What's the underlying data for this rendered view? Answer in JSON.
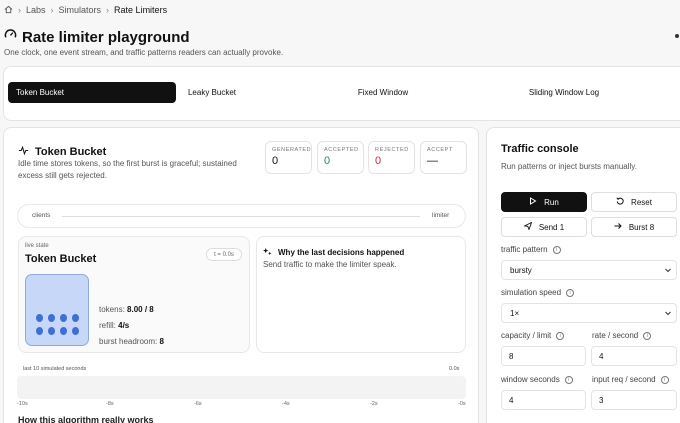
{
  "breadcrumb": {
    "items": [
      "Labs",
      "Simulators"
    ],
    "current": "Rate Limiters"
  },
  "header": {
    "title": "Rate limiter playground",
    "subtitle": "One clock, one event stream, and traffic patterns readers can actually provoke."
  },
  "tabs": [
    {
      "label": "Token Bucket",
      "active": true
    },
    {
      "label": "Leaky Bucket",
      "active": false
    },
    {
      "label": "Fixed Window",
      "active": false
    },
    {
      "label": "Sliding Window Log",
      "active": false
    }
  ],
  "main": {
    "title": "Token Bucket",
    "description": "Idle time stores tokens, so the first burst is graceful; sustained excess still gets rejected.",
    "stats": [
      {
        "label": "GENERATED",
        "value": "0",
        "color": "#111111"
      },
      {
        "label": "ACCEPTED",
        "value": "0",
        "color": "#1f8a5b"
      },
      {
        "label": "REJECTED",
        "value": "0",
        "color": "#c8283c"
      },
      {
        "label": "ACCEPT",
        "value": "—",
        "color": "#111111"
      }
    ],
    "lane": {
      "left": "clients",
      "right": "limiter"
    },
    "state": {
      "eyebrow": "live state",
      "title": "Token Bucket",
      "clock": "t = 0.0s",
      "tokens_label": "tokens:",
      "tokens_value": "8.00 / 8",
      "refill_label": "refill:",
      "refill_value": "4/s",
      "headroom_label": "burst headroom:",
      "headroom_value": "8",
      "fill_fraction": 1.0
    },
    "why": {
      "title": "Why the last decisions happened",
      "body": "Send traffic to make the limiter speak."
    },
    "timeline": {
      "label": "last 10 simulated seconds",
      "now": "0.0s",
      "ticks": [
        "-10s",
        "-8s",
        "-6s",
        "-4s",
        "-2s",
        "-0s"
      ]
    },
    "next_section": "How this algorithm really works"
  },
  "console": {
    "title": "Traffic console",
    "description": "Run patterns or inject bursts manually.",
    "run_label": "Run",
    "reset_label": "Reset",
    "send1_label": "Send 1",
    "send8_label": "Burst 8",
    "pattern_label": "traffic pattern",
    "pattern_value": "bursty",
    "speed_label": "simulation speed",
    "speed_value": "1×",
    "capacity_label": "capacity / limit",
    "capacity_value": "8",
    "rate_label": "rate / second",
    "rate_value": "4",
    "window_label": "window seconds",
    "window_value": "4",
    "input_rate_label": "input req / second",
    "input_rate_value": "3"
  },
  "icons": [
    "home-icon",
    "gauge-icon",
    "pulse-icon",
    "sparkles-icon",
    "play-icon",
    "reset-icon",
    "send-icon",
    "arrow-right-icon",
    "info-icon",
    "chevron-down-icon"
  ]
}
